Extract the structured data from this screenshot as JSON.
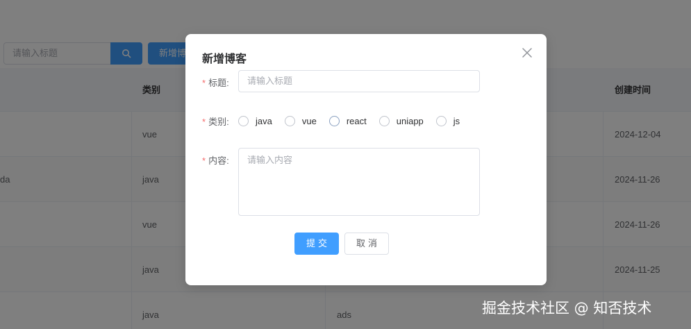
{
  "search": {
    "placeholder": "请输入标题"
  },
  "toolbar": {
    "new_label": "新增博"
  },
  "table": {
    "headers": {
      "category": "类别",
      "created": "创建时间"
    },
    "rows": [
      {
        "title": "",
        "category": "vue",
        "content": "",
        "created": "2024-12-04"
      },
      {
        "title": "da",
        "category": "java",
        "content": "",
        "created": "2024-11-26"
      },
      {
        "title": "",
        "category": "vue",
        "content": "",
        "created": "2024-11-26"
      },
      {
        "title": "",
        "category": "java",
        "content": "",
        "created": "2024-11-25"
      },
      {
        "title": "",
        "category": "java",
        "content": "ads",
        "created": ""
      }
    ]
  },
  "dialog": {
    "title": "新增博客",
    "fields": {
      "title_label": "标题:",
      "title_placeholder": "请输入标题",
      "category_label": "类别:",
      "content_label": "内容:",
      "content_placeholder": "请输入内容"
    },
    "category_options": [
      "java",
      "vue",
      "react",
      "uniapp",
      "js"
    ],
    "submit_label": "提交",
    "cancel_label": "取消"
  },
  "watermark": "掘金技术社区 @ 知否技术",
  "colors": {
    "primary": "#409eff",
    "required": "#f56c6c",
    "overlay": "rgba(0,0,0,0.5)"
  }
}
